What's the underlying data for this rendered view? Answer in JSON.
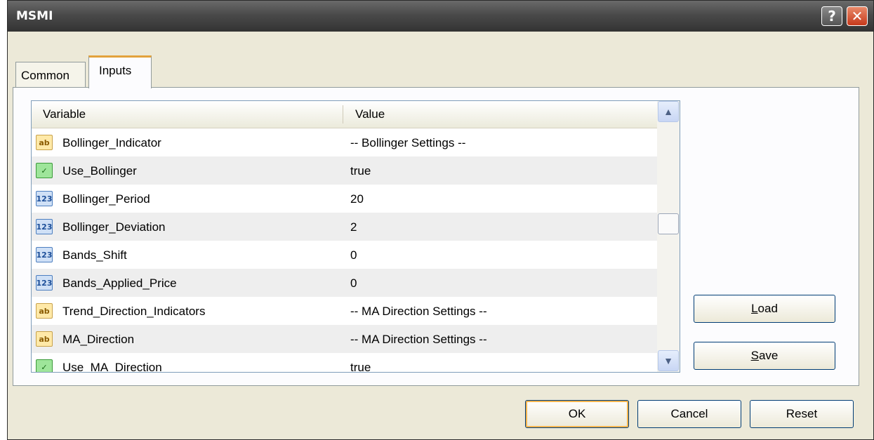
{
  "window": {
    "title": "MSMI"
  },
  "titlebar": {
    "help_label": "?",
    "close_label": "✕"
  },
  "tabs": [
    {
      "label": "Common",
      "active": false
    },
    {
      "label": "Inputs",
      "active": true
    }
  ],
  "grid": {
    "columns": [
      "Variable",
      "Value"
    ],
    "rows": [
      {
        "icon": "string-type-icon",
        "icon_text": "ab",
        "variable": "Bollinger_Indicator",
        "value": "-- Bollinger Settings --"
      },
      {
        "icon": "boolean-type-icon",
        "icon_text": "✓",
        "variable": "Use_Bollinger",
        "value": "true"
      },
      {
        "icon": "integer-type-icon",
        "icon_text": "123",
        "variable": "Bollinger_Period",
        "value": "20"
      },
      {
        "icon": "integer-type-icon",
        "icon_text": "123",
        "variable": "Bollinger_Deviation",
        "value": "2"
      },
      {
        "icon": "integer-type-icon",
        "icon_text": "123",
        "variable": "Bands_Shift",
        "value": "0"
      },
      {
        "icon": "integer-type-icon",
        "icon_text": "123",
        "variable": "Bands_Applied_Price",
        "value": "0"
      },
      {
        "icon": "string-type-icon",
        "icon_text": "ab",
        "variable": "Trend_Direction_Indicators",
        "value": "-- MA Direction Settings --"
      },
      {
        "icon": "string-type-icon",
        "icon_text": "ab",
        "variable": "MA_Direction",
        "value": "-- MA Direction Settings --"
      },
      {
        "icon": "boolean-type-icon",
        "icon_text": "✓",
        "variable": "Use_MA_Direction",
        "value": "true"
      }
    ]
  },
  "scrollbar": {
    "up_label": "▲",
    "down_label": "▼"
  },
  "side_buttons": {
    "load_prefix": "L",
    "load_rest": "oad",
    "save_prefix": "S",
    "save_rest": "ave"
  },
  "footer": {
    "ok": "OK",
    "cancel": "Cancel",
    "reset": "Reset"
  }
}
